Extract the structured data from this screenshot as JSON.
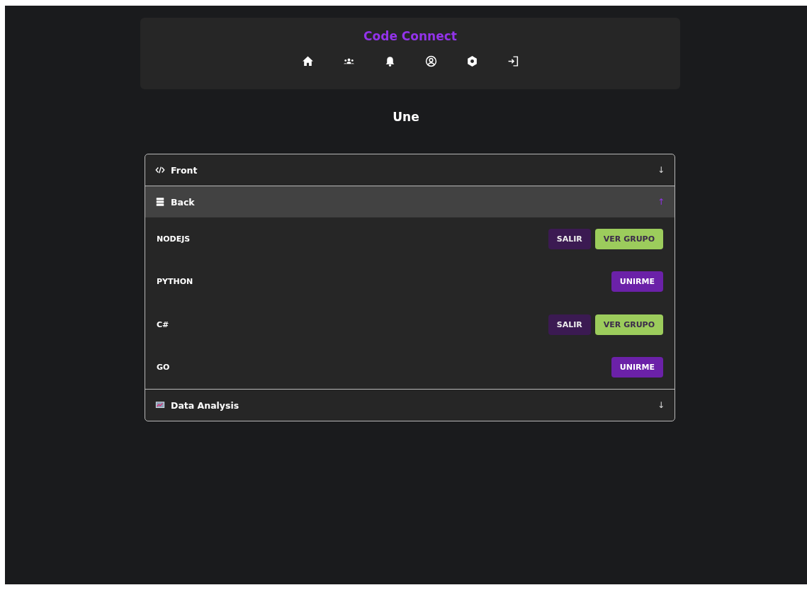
{
  "header": {
    "title": "Code Connect",
    "nav": [
      {
        "kind": "home"
      },
      {
        "kind": "groups"
      },
      {
        "kind": "bell"
      },
      {
        "kind": "profile"
      },
      {
        "kind": "settings"
      },
      {
        "kind": "logout"
      }
    ]
  },
  "page_title": "Une",
  "sections": [
    {
      "label": "Front",
      "kind": "code",
      "expanded": false,
      "arrow": "↓"
    },
    {
      "label": "Back",
      "kind": "server",
      "expanded": true,
      "arrow": "↑",
      "groups": [
        {
          "name": "NODEJS",
          "actions": [
            {
              "label": "SALIR",
              "kind": "leave"
            },
            {
              "label": "VER GRUPO",
              "kind": "view"
            }
          ]
        },
        {
          "name": "PYTHON",
          "actions": [
            {
              "label": "UNIRME",
              "kind": "join"
            }
          ]
        },
        {
          "name": "C#",
          "actions": [
            {
              "label": "SALIR",
              "kind": "leave"
            },
            {
              "label": "VER GRUPO",
              "kind": "view"
            }
          ]
        },
        {
          "name": "GO",
          "actions": [
            {
              "label": "UNIRME",
              "kind": "join"
            }
          ]
        }
      ]
    },
    {
      "label": "Data Analysis",
      "kind": "chart",
      "expanded": false,
      "arrow": "↓"
    }
  ]
}
